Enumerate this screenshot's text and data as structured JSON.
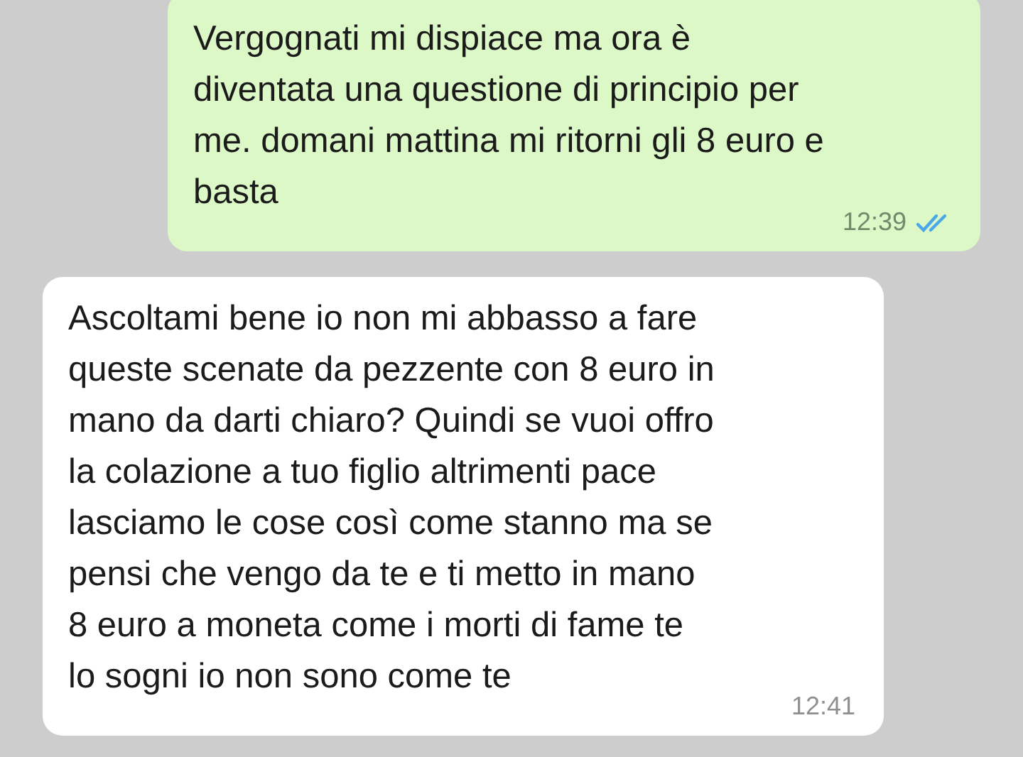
{
  "messages": [
    {
      "kind": "outgoing",
      "lines": [
        "Vergognati mi dispiace ma ora è",
        "diventata una questione di principio per",
        "me. domani mattina mi ritorni gli 8 euro e",
        "basta"
      ],
      "time": "12:39",
      "read": true
    },
    {
      "kind": "incoming",
      "lines": [
        "Ascoltami bene io non mi abbasso a fare",
        "queste scenate da pezzente con 8 euro in",
        "mano da darti chiaro? Quindi se vuoi offro",
        "la colazione a tuo figlio altrimenti pace",
        "lasciamo le cose così come stanno ma se",
        "pensi che vengo da te e ti metto in mano",
        "8 euro a moneta come i morti di fame te",
        "lo sogni io non sono come te"
      ],
      "time": "12:41"
    }
  ]
}
